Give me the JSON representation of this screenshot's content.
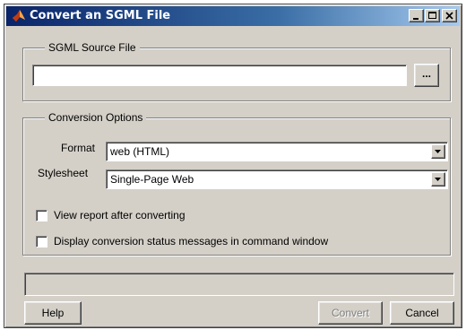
{
  "window": {
    "title": "Convert an SGML File",
    "icons": [
      "matlab-icon",
      "minimize-icon",
      "maximize-icon",
      "close-icon"
    ]
  },
  "source_group": {
    "legend": "SGML Source File",
    "path_value": "",
    "browse_label": "..."
  },
  "options_group": {
    "legend": "Conversion Options",
    "format_label": "Format",
    "format_value": "web (HTML)",
    "stylesheet_label": "Stylesheet",
    "stylesheet_value": "Single-Page Web",
    "checkboxes": [
      {
        "label": "View report after converting",
        "checked": false
      },
      {
        "label": "Display conversion status messages in command window",
        "checked": false
      }
    ]
  },
  "status": {
    "text": ""
  },
  "buttons": {
    "help": "Help",
    "convert": "Convert",
    "cancel": "Cancel"
  }
}
